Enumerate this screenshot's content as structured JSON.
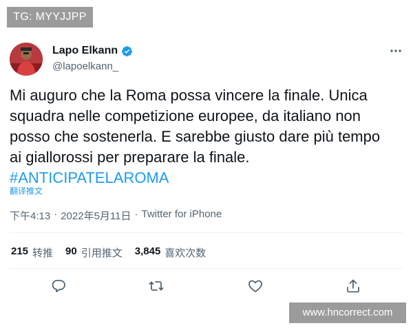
{
  "overlays": {
    "tag": "TG: MYYJJPP",
    "site": "www.hncorrect.com"
  },
  "author": {
    "display_name": "Lapo Elkann",
    "handle": "@lapoelkann_",
    "verified": true,
    "avatar_icon": "profile-photo"
  },
  "tweet": {
    "text_lines": [
      "Mi auguro che la Roma possa vincere la finale. Unica",
      "squadra nelle competizione europee, da italiano non",
      "posso che sostenerla. E sarebbe giusto dare più tempo",
      "ai giallorossi per preparare la finale."
    ],
    "hashtag": "#ANTICIPATELAROMA",
    "translate_label": "翻译推文"
  },
  "meta": {
    "time": "下午4:13",
    "separator": "·",
    "date": "2022年5月11日",
    "source": "Twitter for iPhone"
  },
  "stats": {
    "retweets_count": "215",
    "retweets_label": "转推",
    "quotes_count": "90",
    "quotes_label": "引用推文",
    "likes_count": "3,845",
    "likes_label": "喜欢次数"
  },
  "colors": {
    "accent": "#1d9bf0",
    "text_primary": "#0f1419",
    "text_secondary": "#536471",
    "overlay_bg": "#9b9b9b"
  },
  "icons": {
    "more": "more-horizontal-icon",
    "reply": "reply-icon",
    "retweet": "retweet-icon",
    "like": "heart-icon",
    "share": "share-icon",
    "verified": "verified-badge-icon"
  }
}
